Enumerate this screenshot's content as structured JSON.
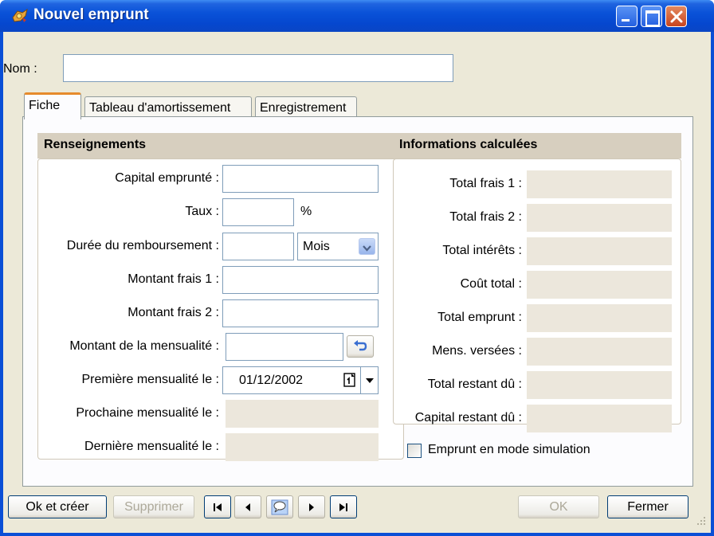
{
  "window": {
    "title": "Nouvel emprunt"
  },
  "nom": {
    "label": "Nom :",
    "value": ""
  },
  "tabs": [
    {
      "label": "Fiche",
      "active": true
    },
    {
      "label": "Tableau d'amortissement",
      "active": false
    },
    {
      "label": "Enregistrement",
      "active": false
    }
  ],
  "renseignements": {
    "title": "Renseignements",
    "capital_label": "Capital emprunté :",
    "capital_value": "",
    "taux_label": "Taux :",
    "taux_value": "",
    "taux_unit": "%",
    "duree_label": "Durée du remboursement :",
    "duree_value": "",
    "duree_unit_selected": "Mois",
    "frais1_label": "Montant frais 1 :",
    "frais1_value": "",
    "frais2_label": "Montant frais 2 :",
    "frais2_value": "",
    "mensualite_label": "Montant de la mensualité :",
    "mensualite_value": "",
    "premiere_label": "Première mensualité le :",
    "premiere_value": "01/12/2002",
    "prochaine_label": "Prochaine mensualité le :",
    "derniere_label": "Dernière mensualité le :"
  },
  "informations": {
    "title": "Informations calculées",
    "total_frais1_label": "Total frais 1 :",
    "total_frais2_label": "Total frais 2 :",
    "total_interets_label": "Total intérêts :",
    "cout_total_label": "Coût total :",
    "total_emprunt_label": "Total emprunt :",
    "mens_versees_label": "Mens. versées :",
    "total_restant_label": "Total restant dû :",
    "capital_restant_label": "Capital restant dû :"
  },
  "simulation": {
    "label": "Emprunt en mode simulation",
    "checked": false
  },
  "buttons": {
    "ok_creer": "Ok et créer",
    "supprimer": "Supprimer",
    "ok": "OK",
    "fermer": "Fermer"
  },
  "colors": {
    "title_bar": "#0a52d8",
    "client_bg": "#ece9d8",
    "group_header": "#d7cfbf",
    "active_tab_accent": "#e68b2c",
    "input_border": "#7f9db9"
  },
  "icons": {
    "app": "loan-app-icon",
    "calculate": "undo-arrow-icon",
    "calendar": "calendar-icon",
    "dropdown": "chevron-down-icon",
    "first": "first-record-icon",
    "previous": "previous-record-icon",
    "list": "speech-bubble-icon",
    "next": "next-record-icon",
    "last": "last-record-icon"
  }
}
